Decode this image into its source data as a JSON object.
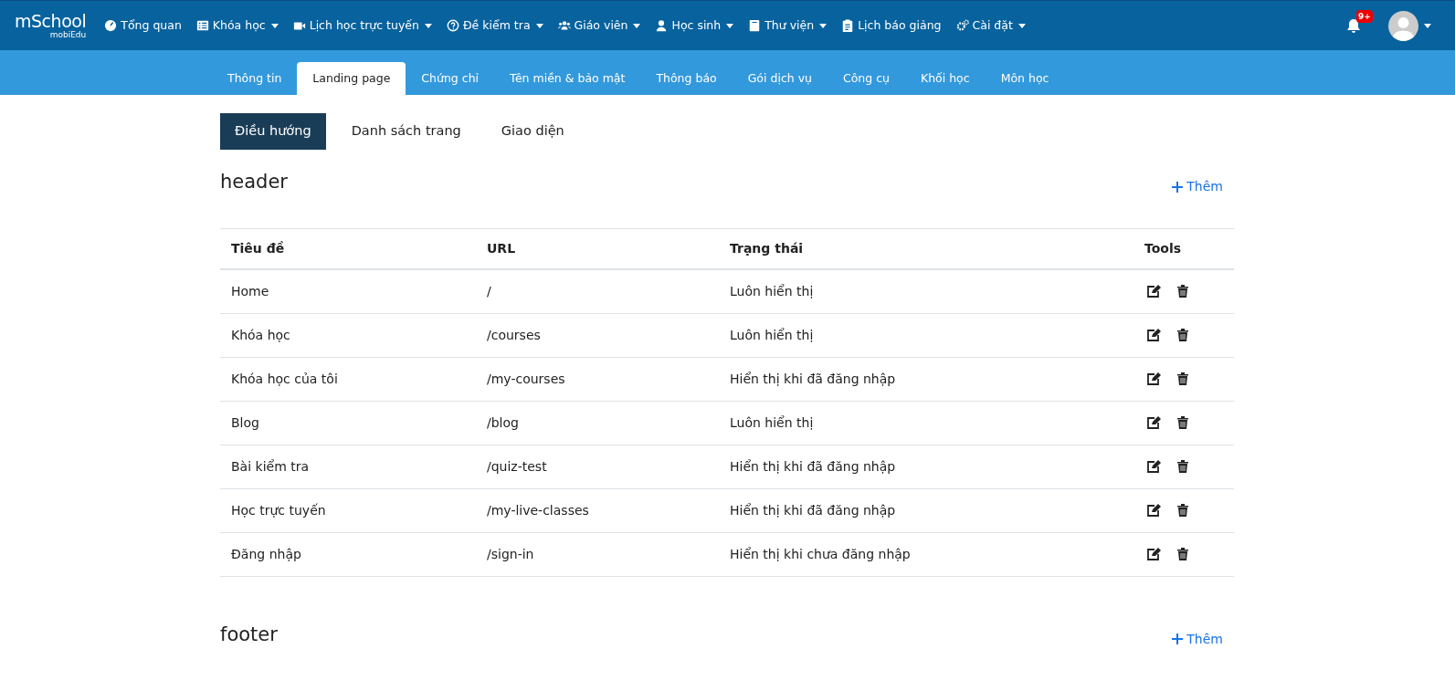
{
  "logo": {
    "text": "mSchool",
    "subtext": "mobiEdu"
  },
  "nav": [
    {
      "label": "Tổng quan",
      "dropdown": false
    },
    {
      "label": "Khóa học",
      "dropdown": true
    },
    {
      "label": "Lịch học trực tuyến",
      "dropdown": true
    },
    {
      "label": "Đề kiểm tra",
      "dropdown": true
    },
    {
      "label": "Giáo viên",
      "dropdown": true
    },
    {
      "label": "Học sinh",
      "dropdown": true
    },
    {
      "label": "Thư viện",
      "dropdown": true
    },
    {
      "label": "Lịch báo giảng",
      "dropdown": false
    },
    {
      "label": "Cài đặt",
      "dropdown": true
    }
  ],
  "notifications": {
    "badge": "9+"
  },
  "tabs": [
    {
      "label": "Thông tin",
      "selected": false
    },
    {
      "label": "Landing page",
      "selected": true
    },
    {
      "label": "Chứng chỉ",
      "selected": false
    },
    {
      "label": "Tên miền & bảo mật",
      "selected": false
    },
    {
      "label": "Thông báo",
      "selected": false
    },
    {
      "label": "Gói dịch vụ",
      "selected": false
    },
    {
      "label": "Công cụ",
      "selected": false
    },
    {
      "label": "Khối học",
      "selected": false
    },
    {
      "label": "Môn học",
      "selected": false
    }
  ],
  "subtabs": [
    {
      "label": "Điều hướng",
      "selected": true
    },
    {
      "label": "Danh sách trang",
      "selected": false
    },
    {
      "label": "Giao diện",
      "selected": false
    }
  ],
  "sections": [
    {
      "title": "header",
      "add_label": "Thêm",
      "columns": [
        "Tiêu đề",
        "URL",
        "Trạng thái",
        "Tools"
      ],
      "rows": [
        [
          "Home",
          "/",
          "Luôn hiển thị"
        ],
        [
          "Khóa học",
          "/courses",
          "Luôn hiển thị"
        ],
        [
          "Khóa học của tôi",
          "/my-courses",
          "Hiển thị khi đã đăng nhập"
        ],
        [
          "Blog",
          "/blog",
          "Luôn hiển thị"
        ],
        [
          "Bài kiểm tra",
          "/quiz-test",
          "Hiển thị khi đã đăng nhập"
        ],
        [
          "Học trực tuyến",
          "/my-live-classes",
          "Hiển thị khi đã đăng nhập"
        ],
        [
          "Đăng nhập",
          "/sign-in",
          "Hiển thị khi chưa đăng nhập"
        ]
      ]
    },
    {
      "title": "footer",
      "add_label": "Thêm"
    }
  ]
}
